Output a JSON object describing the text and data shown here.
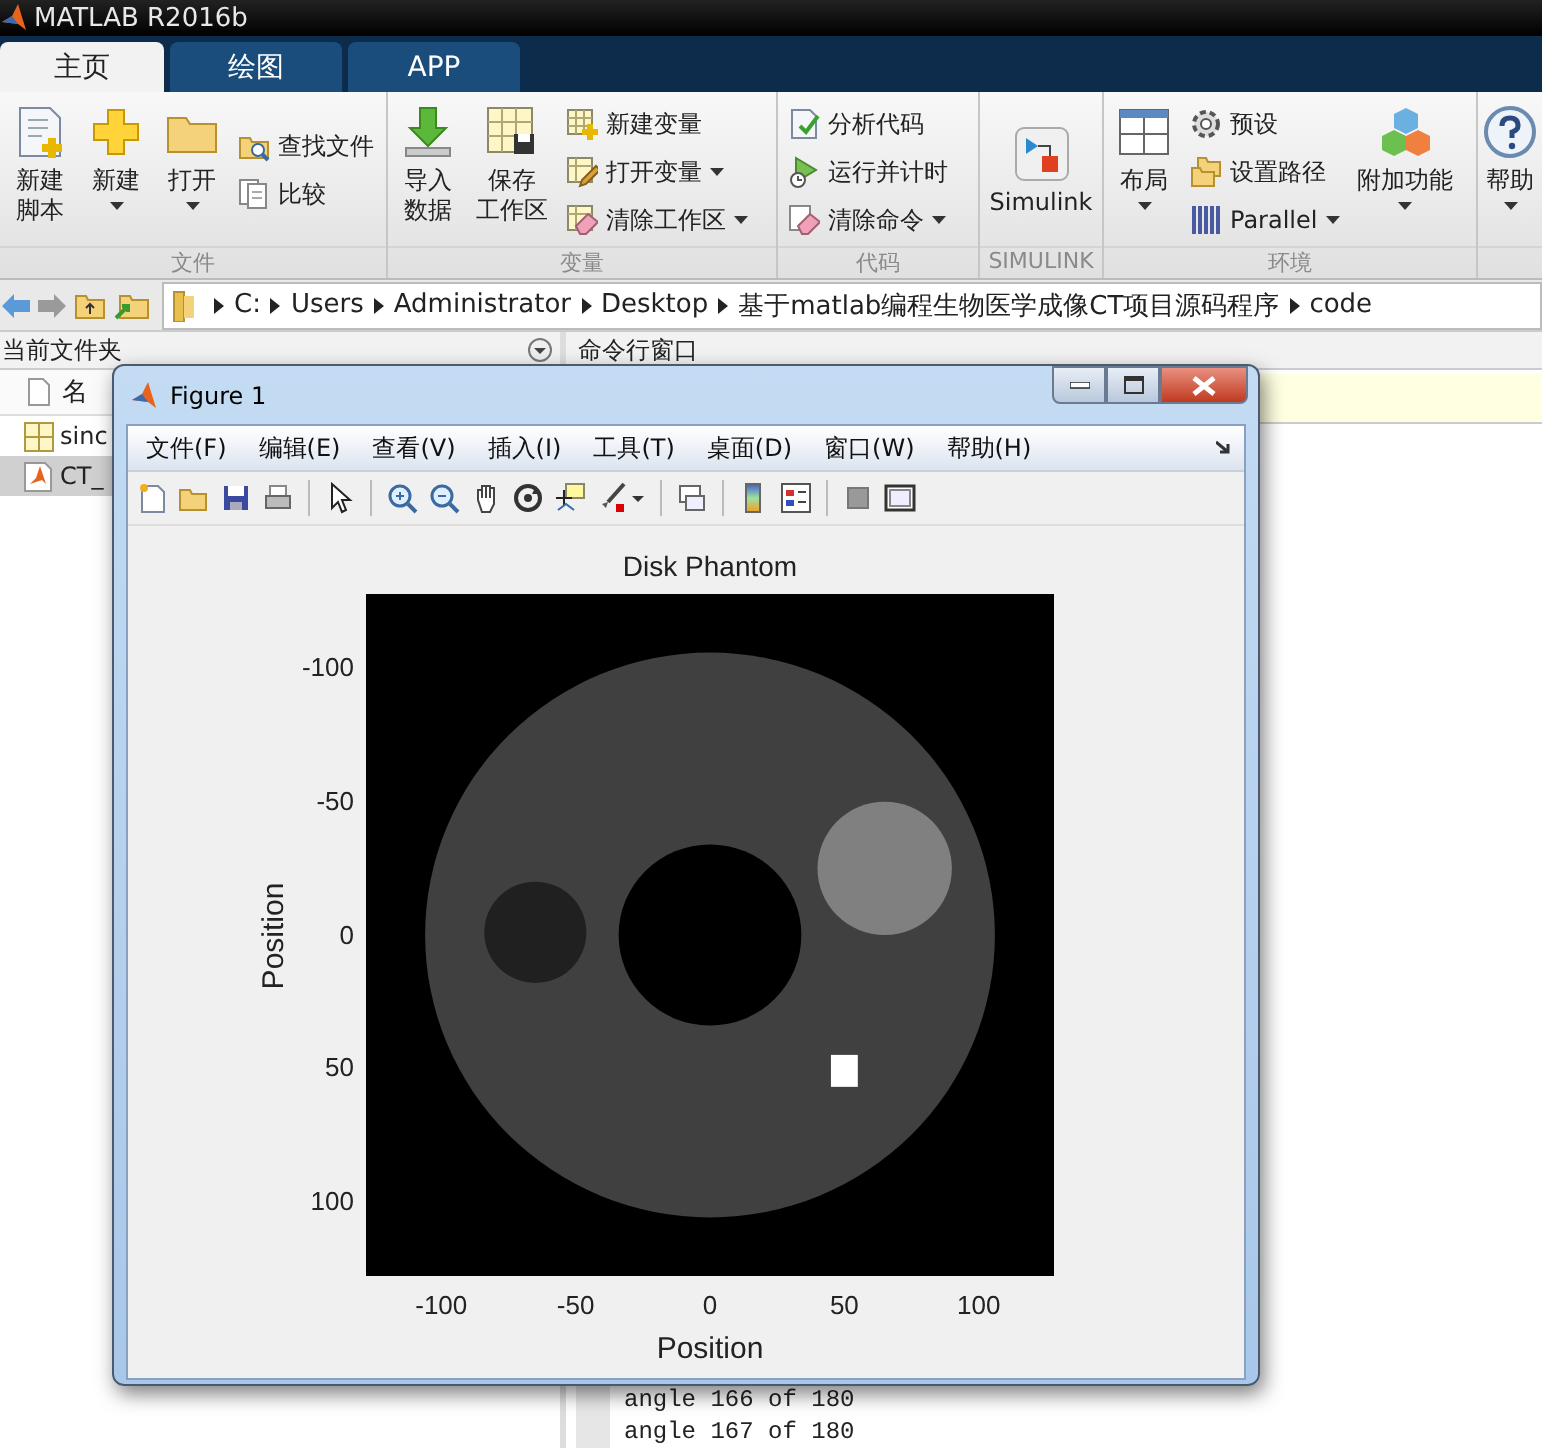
{
  "window": {
    "title": "MATLAB R2016b"
  },
  "ribbon_tabs": [
    {
      "label": "主页",
      "selected": true
    },
    {
      "label": "绘图",
      "selected": false
    },
    {
      "label": "APP",
      "selected": false
    }
  ],
  "ribbon_groups": [
    {
      "label": "文件",
      "columns": [
        {
          "kind": "large",
          "label": [
            "新建",
            "脚本"
          ],
          "dropdown": false
        },
        {
          "kind": "large",
          "label": "新建",
          "dropdown": true
        },
        {
          "kind": "large",
          "label": "打开",
          "dropdown": true
        },
        {
          "kind": "stack",
          "items": [
            {
              "label": "查找文件",
              "dropdown": false
            },
            {
              "label": "比较",
              "dropdown": false
            }
          ]
        }
      ]
    },
    {
      "label": "变量",
      "columns": [
        {
          "kind": "large",
          "label": [
            "导入",
            "数据"
          ],
          "dropdown": false
        },
        {
          "kind": "large",
          "label": [
            "保存",
            "工作区"
          ],
          "dropdown": false
        },
        {
          "kind": "stack",
          "items": [
            {
              "label": "新建变量",
              "dropdown": false
            },
            {
              "label": "打开变量",
              "dropdown": true
            },
            {
              "label": "清除工作区",
              "dropdown": true
            }
          ]
        }
      ]
    },
    {
      "label": "代码",
      "columns": [
        {
          "kind": "stack",
          "items": [
            {
              "label": "分析代码",
              "dropdown": false
            },
            {
              "label": "运行并计时",
              "dropdown": false
            },
            {
              "label": "清除命令",
              "dropdown": true
            }
          ]
        }
      ]
    },
    {
      "label": "SIMULINK",
      "columns": [
        {
          "kind": "large",
          "label": "Simulink",
          "dropdown": false
        }
      ]
    },
    {
      "label": "环境",
      "columns": [
        {
          "kind": "large",
          "label": "布局",
          "dropdown": true
        },
        {
          "kind": "stack",
          "items": [
            {
              "label": "预设",
              "dropdown": false
            },
            {
              "label": "设置路径",
              "dropdown": false
            },
            {
              "label": "Parallel",
              "dropdown": true
            }
          ]
        },
        {
          "kind": "large",
          "label": "附加功能",
          "dropdown": true
        }
      ]
    },
    {
      "columns": [
        {
          "kind": "large",
          "label": "帮助",
          "dropdown": true
        }
      ]
    }
  ],
  "address_bar": {
    "crumbs": [
      "C:",
      "Users",
      "Administrator",
      "Desktop",
      "基于matlab编程生物医学成像CT项目源码程序",
      "code"
    ]
  },
  "current_folder": {
    "title": "当前文件夹",
    "column": "名",
    "files": [
      {
        "name": "sinc",
        "selected": false
      },
      {
        "name": "CT_",
        "selected": true
      }
    ]
  },
  "command_window": {
    "title": "命令行窗口",
    "lines": [
      "angle 166 of 180",
      "angle 167 of 180"
    ]
  },
  "figure": {
    "title": "Figure 1",
    "menus": [
      "文件(F)",
      "编辑(E)",
      "查看(V)",
      "插入(I)",
      "工具(T)",
      "桌面(D)",
      "窗口(W)",
      "帮助(H)"
    ],
    "axes": {
      "title": "Disk Phantom",
      "xlabel": "Position",
      "ylabel": "Position",
      "xtick_labels": [
        "-100",
        "-50",
        "0",
        "50",
        "100"
      ],
      "ytick_labels": [
        "-100",
        "-50",
        "0",
        "50",
        "100"
      ]
    }
  }
}
